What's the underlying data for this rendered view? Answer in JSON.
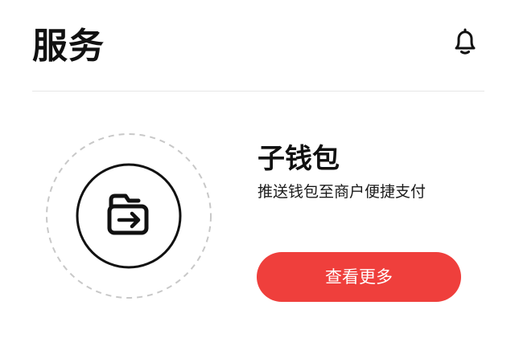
{
  "header": {
    "title": "服务",
    "notification_icon": "bell-icon"
  },
  "feature": {
    "icon": "wallet-transfer-icon",
    "title": "子钱包",
    "description": "推送钱包至商户便捷支付",
    "cta_label": "查看更多"
  },
  "colors": {
    "accent": "#ef3f3c",
    "text": "#111111",
    "divider": "#e6e6e6",
    "dashed_ring": "#c8c8c8"
  }
}
